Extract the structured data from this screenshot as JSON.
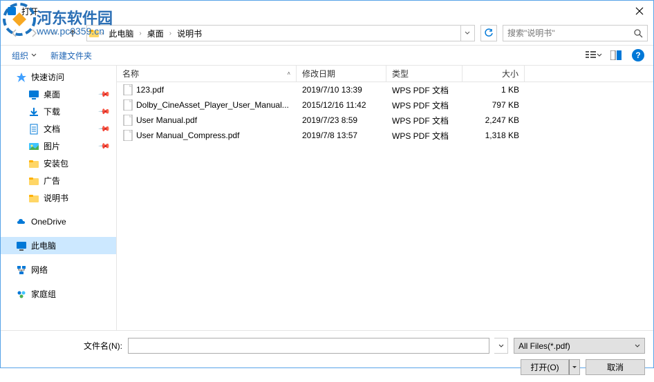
{
  "titlebar": {
    "title": "打开"
  },
  "watermark": {
    "text": "河东软件园",
    "url": "www.pc0359.cn"
  },
  "breadcrumb": {
    "items": [
      "此电脑",
      "桌面",
      "说明书"
    ]
  },
  "search": {
    "placeholder": "搜索\"说明书\""
  },
  "toolbar": {
    "organize": "组织",
    "newfolder": "新建文件夹"
  },
  "sidebar": {
    "quickaccess": "快速访问",
    "desktop": "桌面",
    "downloads": "下载",
    "documents": "文档",
    "pictures": "图片",
    "installpack": "安装包",
    "ads": "广告",
    "manual": "说明书",
    "onedrive": "OneDrive",
    "thispc": "此电脑",
    "network": "网络",
    "homegroup": "家庭组"
  },
  "columns": {
    "name": "名称",
    "date": "修改日期",
    "type": "类型",
    "size": "大小"
  },
  "files": [
    {
      "name": "123.pdf",
      "date": "2019/7/10 13:39",
      "type": "WPS PDF 文档",
      "size": "1 KB"
    },
    {
      "name": "Dolby_CineAsset_Player_User_Manual...",
      "date": "2015/12/16 11:42",
      "type": "WPS PDF 文档",
      "size": "797 KB"
    },
    {
      "name": "User Manual.pdf",
      "date": "2019/7/23 8:59",
      "type": "WPS PDF 文档",
      "size": "2,247 KB"
    },
    {
      "name": "User Manual_Compress.pdf",
      "date": "2019/7/8 13:57",
      "type": "WPS PDF 文档",
      "size": "1,318 KB"
    }
  ],
  "bottom": {
    "filename_label": "文件名(N):",
    "filter": "All Files(*.pdf)",
    "open_btn": "打开(O)",
    "cancel_btn": "取消"
  }
}
